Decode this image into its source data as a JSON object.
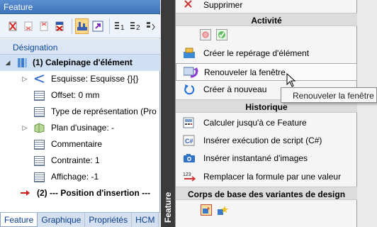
{
  "panel": {
    "title": "Feature",
    "tree_header": "Désignation",
    "tree": {
      "root": "(1) Calepinage d'élément",
      "children": [
        "Esquisse: Esquisse {}{}",
        "Offset: 0 mm",
        "Type de représentation (Pro",
        "Plan d'usinage: -",
        "Commentaire",
        "Contrainte: 1",
        "Affichage: -1"
      ],
      "next": "(2) --- Position  d'insertion ---"
    },
    "tabs": [
      "Feature",
      "Graphique",
      "Propriétés",
      "HCM"
    ],
    "side_label": "Feature"
  },
  "menu": {
    "supprimer": "Supprimer",
    "section_activite": "Activité",
    "creer_reperage": "Créer le repérage d'élément",
    "renouveler": "Renouveler la fenêtre",
    "creer_nouveau": "Créer à nouveau",
    "section_historique": "Historique",
    "calculer": "Calculer jusqu'à ce Feature",
    "inserer_script": "Insérer exécution de script (C#)",
    "inserer_instantane": "Insérer instantané d'images",
    "remplacer_formule": "Remplacer la formule par une valeur",
    "section_corps": "Corps de base des variantes de design",
    "csharp_icon_text": "C#",
    "formula_icon_text": "123"
  },
  "tooltip": "Renouveler la fenêtre",
  "colors": {
    "title_bar": "#4a80c6",
    "selected_row": "#cfe0f5",
    "accent_blue": "#0b47a1",
    "menu_section": "#dcdcdc",
    "strip": "#3b3b3b"
  }
}
